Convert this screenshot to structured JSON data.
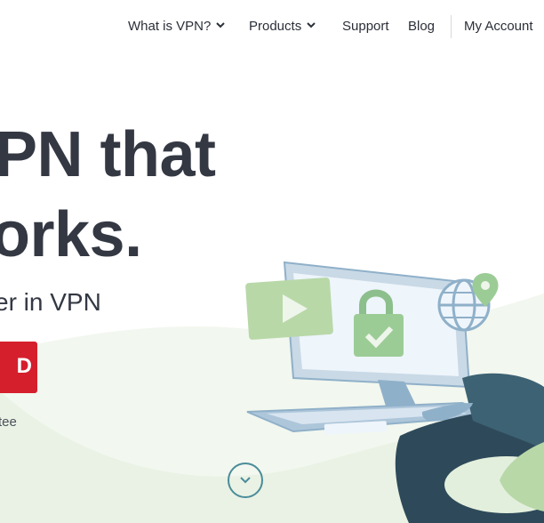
{
  "nav": {
    "what_is_vpn": "What is VPN?",
    "products": "Products",
    "support": "Support",
    "blog": "Blog",
    "my_account": "My Account"
  },
  "hero": {
    "line1": "PN that",
    "line2": "orks.",
    "subtitle": "er in VPN",
    "cta_label": "D",
    "guarantee": "tee"
  },
  "colors": {
    "cta_red": "#d51f2d",
    "heading": "#333843",
    "wave_green": "#eef5ea",
    "accent_teal": "#4a8c9a"
  },
  "icons": {
    "nav_chevron": "chevron-down-icon",
    "scroll": "chevron-down-circle-icon",
    "play": "play-icon",
    "lock": "lock-icon",
    "globe": "globe-icon",
    "pin": "map-pin-icon"
  }
}
